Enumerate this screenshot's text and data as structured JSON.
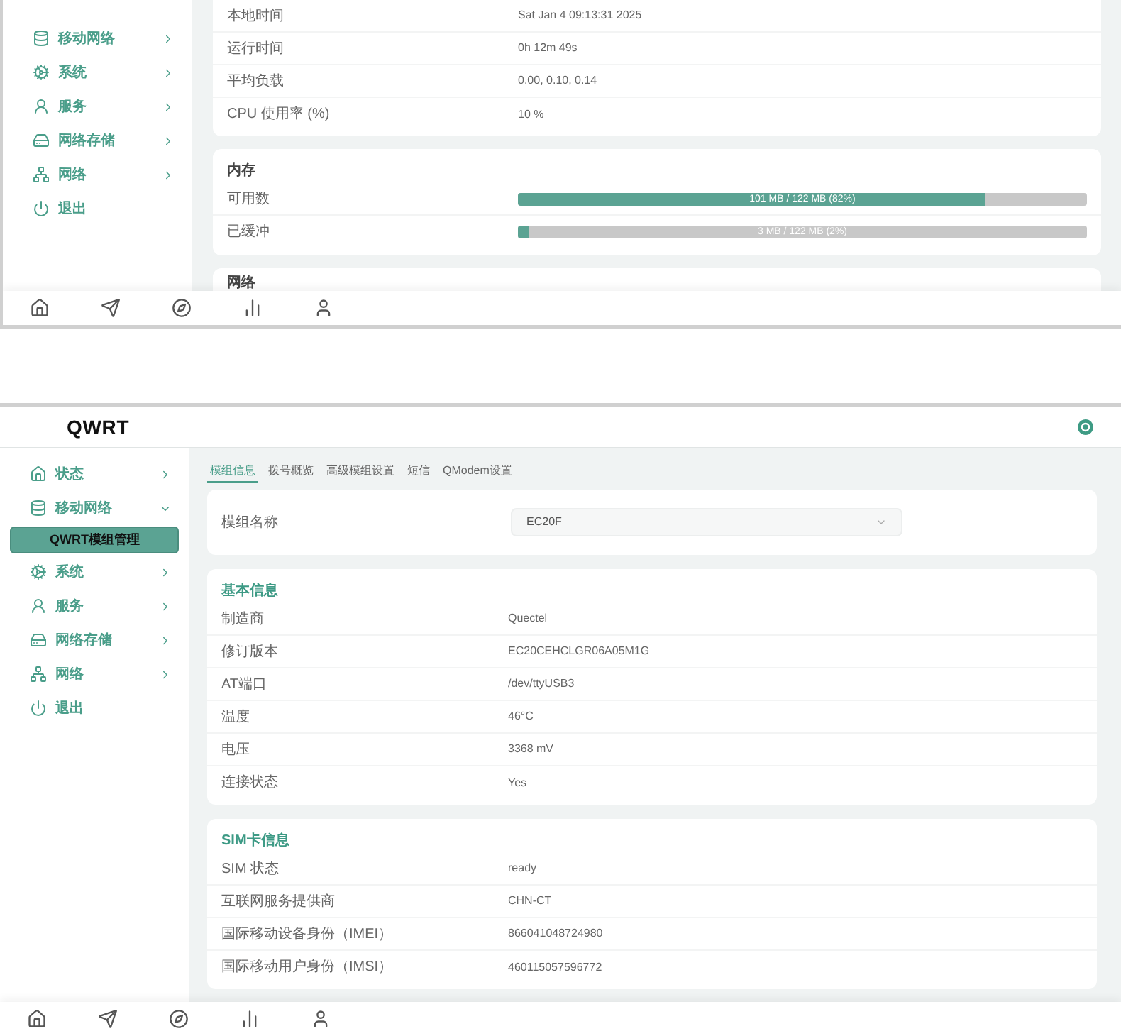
{
  "status_view": {
    "sidebar": {
      "items": [
        {
          "label": "移动网络",
          "kind": "menu",
          "expanded": false
        },
        {
          "label": "系统",
          "kind": "menu",
          "expanded": false
        },
        {
          "label": "服务",
          "kind": "menu",
          "expanded": false
        },
        {
          "label": "网络存储",
          "kind": "menu",
          "expanded": false
        },
        {
          "label": "网络",
          "kind": "menu",
          "expanded": false
        },
        {
          "label": "退出",
          "kind": "action"
        }
      ]
    },
    "system_rows": [
      {
        "label": "本地时间",
        "value": "Sat Jan 4 09:13:31 2025"
      },
      {
        "label": "运行时间",
        "value": "0h 12m 49s"
      },
      {
        "label": "平均负载",
        "value": "0.00, 0.10, 0.14"
      },
      {
        "label": "CPU 使用率 (%)",
        "value": "10 %"
      }
    ],
    "memory": {
      "title": "内存",
      "bars": [
        {
          "label": "可用数",
          "text": "101 MB / 122 MB (82%)",
          "level": 0.82
        },
        {
          "label": "已缓冲",
          "text": "3 MB / 122 MB (2%)",
          "level": 0.02
        }
      ]
    },
    "network": {
      "title": "网络"
    }
  },
  "modem_view": {
    "brand": "QWRT",
    "sidebar": {
      "items": [
        {
          "label": "状态",
          "kind": "menu",
          "expanded": false
        },
        {
          "label": "移动网络",
          "kind": "menu",
          "expanded": true,
          "children": [
            {
              "label": "QWRT模组管理",
              "selected": true
            }
          ]
        },
        {
          "label": "系统",
          "kind": "menu",
          "expanded": false
        },
        {
          "label": "服务",
          "kind": "menu",
          "expanded": false
        },
        {
          "label": "网络存储",
          "kind": "menu",
          "expanded": false
        },
        {
          "label": "网络",
          "kind": "menu",
          "expanded": false
        },
        {
          "label": "退出",
          "kind": "action"
        }
      ]
    },
    "tabs": [
      {
        "label": "模组信息",
        "selected": true
      },
      {
        "label": "拨号概览",
        "selected": false
      },
      {
        "label": "高级模组设置",
        "selected": false
      },
      {
        "label": "短信",
        "selected": false
      },
      {
        "label": "QModem设置",
        "selected": false
      }
    ],
    "module_select": {
      "label": "模组名称",
      "value": "EC20F"
    },
    "sections": [
      {
        "title": "基本信息",
        "rows": [
          {
            "label": "制造商",
            "value": "Quectel"
          },
          {
            "label": "修订版本",
            "value": "EC20CEHCLGR06A05M1G"
          },
          {
            "label": "AT端口",
            "value": "/dev/ttyUSB3"
          },
          {
            "label": "温度",
            "value": "46°C"
          },
          {
            "label": "电压",
            "value": "3368 mV"
          },
          {
            "label": "连接状态",
            "value": "Yes"
          }
        ]
      },
      {
        "title": "SIM卡信息",
        "rows": [
          {
            "label": "SIM 状态",
            "value": "ready"
          },
          {
            "label": "互联网服务提供商",
            "value": "CHN-CT"
          },
          {
            "label": "国际移动设备身份（IMEI）",
            "value": "866041048724980"
          },
          {
            "label": "国际移动用户身份（IMSI）",
            "value": "460115057596772"
          }
        ]
      }
    ]
  }
}
